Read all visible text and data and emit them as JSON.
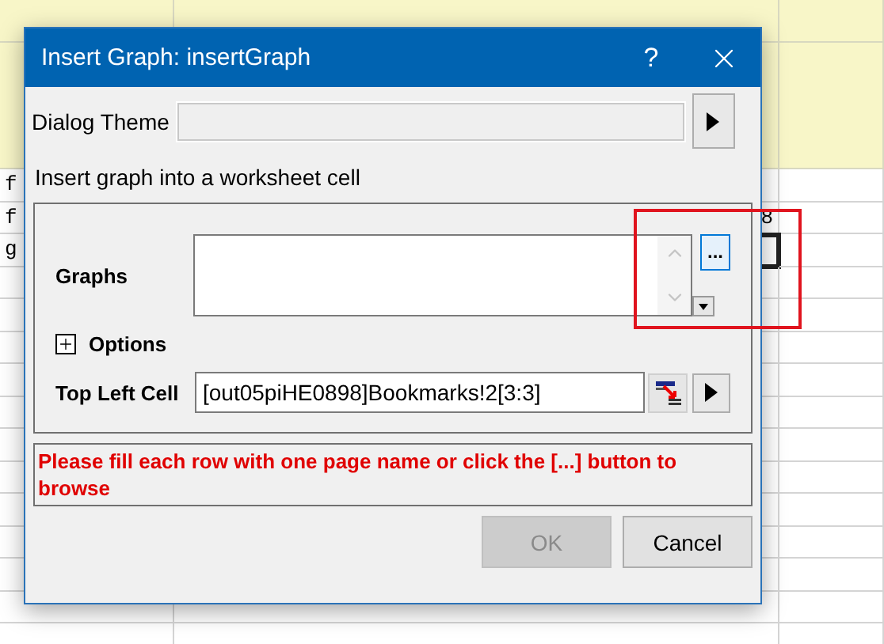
{
  "sheet": {
    "rows": [
      {
        "column_1": "f",
        "selected": false
      },
      {
        "column_1": "f",
        "column_2": "8",
        "selected": false
      },
      {
        "column_1": "g",
        "selected": true
      }
    ]
  },
  "dialog": {
    "title": "Insert Graph: insertGraph",
    "help": "?",
    "theme": {
      "label": "Dialog Theme"
    },
    "description": "Insert graph into a worksheet cell",
    "graphs": {
      "label": "Graphs",
      "browse": "..."
    },
    "options": {
      "label": "Options",
      "expanded": false
    },
    "top_left_cell": {
      "label": "Top Left Cell",
      "value": "[out05piHE0898]Bookmarks!2[3:3]"
    },
    "message": "Please fill each row with one page name or click the [...] button to browse",
    "buttons": [
      {
        "label": "OK",
        "disabled": true
      },
      {
        "label": "Cancel",
        "disabled": false
      }
    ]
  }
}
